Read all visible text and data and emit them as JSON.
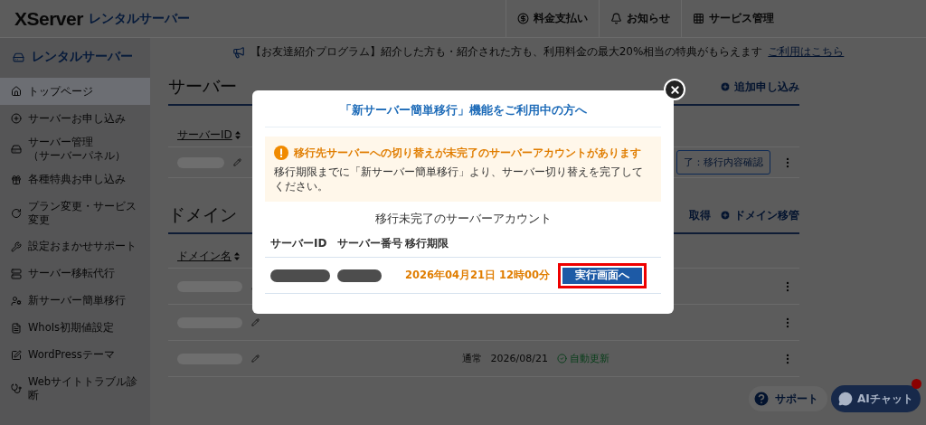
{
  "header": {
    "logo": "XServer",
    "logo_sub": "レンタルサーバー",
    "nav": [
      "料金支払い",
      "お知らせ",
      "サービス管理"
    ]
  },
  "sidebar": {
    "title": "レンタルサーバー",
    "items": [
      {
        "label": "トップページ",
        "selected": true
      },
      {
        "label": "サーバーお申し込み",
        "selected": false
      },
      {
        "label": "サーバー管理",
        "sublabel": "（サーバーパネル）",
        "selected": false
      },
      {
        "label": "各種特典お申し込み",
        "selected": false
      },
      {
        "label": "プラン変更・サービス変更",
        "selected": false
      },
      {
        "label": "設定おまかせサポート",
        "selected": false
      },
      {
        "label": "サーバー移転代行",
        "selected": false
      },
      {
        "label": "新サーバー簡単移行",
        "selected": false
      },
      {
        "label": "WhoIs初期値設定",
        "selected": false
      },
      {
        "label": "WordPressテーマ",
        "selected": false
      },
      {
        "label": "Webサイトトラブル診断",
        "selected": false
      }
    ]
  },
  "banner": {
    "text": "【お友達紹介プログラム】紹介した方も・紹介された方も、利用料金の最大20%相当の特典がもらえます",
    "link": "ご利用はこちら"
  },
  "server_section": {
    "title": "サーバー",
    "actions": [
      {
        "label": "追加申し込み",
        "icon": true
      }
    ],
    "column": "サーバーID",
    "rows": [
      {
        "button": "了：移行内容確認"
      }
    ]
  },
  "domain_section": {
    "title": "ドメイン",
    "actions": [
      {
        "label": "取得",
        "icon": false
      },
      {
        "label": "ドメイン移管",
        "icon": true
      }
    ],
    "column": "ドメイン名",
    "rows": [
      {
        "kind": "name"
      },
      {
        "kind": "name"
      },
      {
        "kind": "full",
        "type": "通常",
        "expiry": "2026/08/21",
        "renewal": "自動更新"
      }
    ]
  },
  "modal": {
    "title": "「新サーバー簡単移行」機能をご利用中の方へ",
    "alert": {
      "heading": "移行先サーバーへの切り替えが未完了のサーバーアカウントがあります",
      "body": "移行期限までに「新サーバー簡単移行」より、サーバー切り替えを完了してください。"
    },
    "subtitle": "移行未完了のサーバーアカウント",
    "columns": [
      "サーバーID",
      "サーバー番号",
      "移行期限"
    ],
    "rows": [
      {
        "deadline": "2026年04月21日 12時00分",
        "button": "実行画面へ"
      }
    ]
  },
  "floating": {
    "support": "サポート",
    "chat": "AIチャット"
  }
}
